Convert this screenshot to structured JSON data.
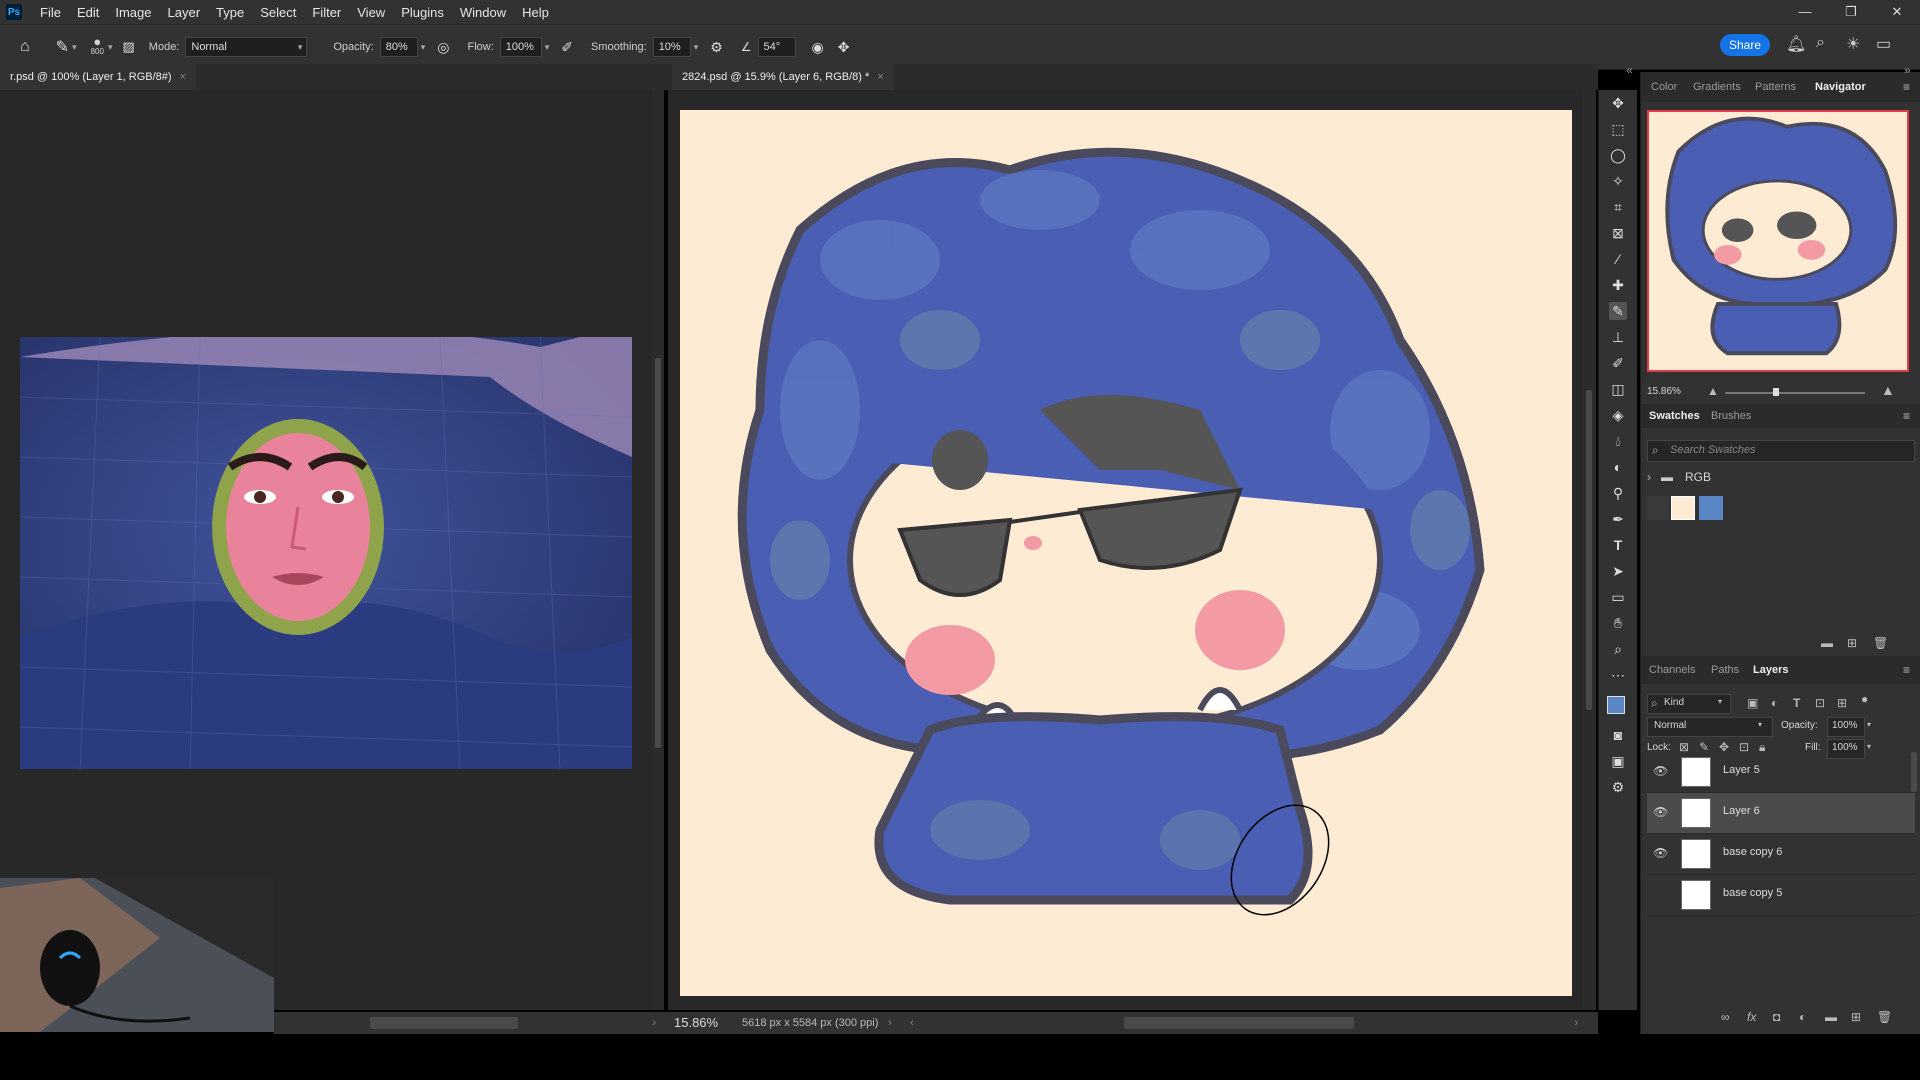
{
  "app": {
    "logo": "Ps",
    "menu": [
      "File",
      "Edit",
      "Image",
      "Layer",
      "Type",
      "Select",
      "Filter",
      "View",
      "Plugins",
      "Window",
      "Help"
    ],
    "window_controls": [
      "—",
      "❐",
      "✕"
    ]
  },
  "options_bar": {
    "brush_size": "800",
    "mode_label": "Mode:",
    "mode_value": "Normal",
    "opacity_label": "Opacity:",
    "opacity_value": "80%",
    "flow_label": "Flow:",
    "flow_value": "100%",
    "smoothing_label": "Smoothing:",
    "smoothing_value": "10%",
    "angle_value": "54°",
    "share_label": "Share"
  },
  "documents": {
    "left_tab": "r.psd @ 100% (Layer 1, RGB/8#)",
    "right_tab": "2824.psd @ 15.9% (Layer 6, RGB/8) *"
  },
  "status": {
    "zoom": "15.86%",
    "doc_info": "5618 px x 5584 px (300 ppi)"
  },
  "panels": {
    "top_tabs": [
      "Color",
      "Gradients",
      "Patterns",
      "Navigator"
    ],
    "navigator_zoom": "15.86%",
    "swatch_tabs": [
      "Swatches",
      "Brushes"
    ],
    "swatch_search_placeholder": "Search Swatches",
    "swatch_group": "RGB",
    "swatch_colors": [
      "#fdebd3",
      "#5b86c6"
    ],
    "layer_tabs": [
      "Channels",
      "Paths",
      "Layers"
    ],
    "kind_label": "Kind",
    "blend_mode": "Normal",
    "opacity_label": "Opacity:",
    "opacity_value": "100%",
    "lock_label": "Lock:",
    "fill_label": "Fill:",
    "fill_value": "100%",
    "layers": [
      {
        "name": "Layer 5",
        "visible": true,
        "selected": false
      },
      {
        "name": "Layer 6",
        "visible": true,
        "selected": true
      },
      {
        "name": "base copy 6",
        "visible": true,
        "selected": false
      },
      {
        "name": "base copy 5",
        "visible": false,
        "selected": false
      }
    ]
  },
  "colors": {
    "accent": "#1473e6",
    "hood_blue": "#4a5fb3",
    "cream": "#fdebd3"
  }
}
